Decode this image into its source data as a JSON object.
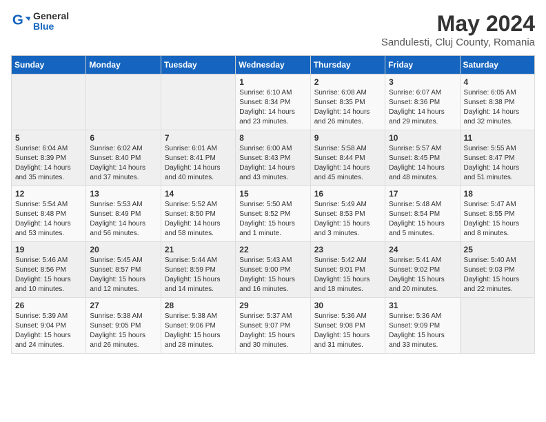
{
  "logo": {
    "general": "General",
    "blue": "Blue"
  },
  "header": {
    "month_year": "May 2024",
    "location": "Sandulesti, Cluj County, Romania"
  },
  "weekdays": [
    "Sunday",
    "Monday",
    "Tuesday",
    "Wednesday",
    "Thursday",
    "Friday",
    "Saturday"
  ],
  "weeks": [
    [
      {
        "day": "",
        "info": ""
      },
      {
        "day": "",
        "info": ""
      },
      {
        "day": "",
        "info": ""
      },
      {
        "day": "1",
        "info": "Sunrise: 6:10 AM\nSunset: 8:34 PM\nDaylight: 14 hours\nand 23 minutes."
      },
      {
        "day": "2",
        "info": "Sunrise: 6:08 AM\nSunset: 8:35 PM\nDaylight: 14 hours\nand 26 minutes."
      },
      {
        "day": "3",
        "info": "Sunrise: 6:07 AM\nSunset: 8:36 PM\nDaylight: 14 hours\nand 29 minutes."
      },
      {
        "day": "4",
        "info": "Sunrise: 6:05 AM\nSunset: 8:38 PM\nDaylight: 14 hours\nand 32 minutes."
      }
    ],
    [
      {
        "day": "5",
        "info": "Sunrise: 6:04 AM\nSunset: 8:39 PM\nDaylight: 14 hours\nand 35 minutes."
      },
      {
        "day": "6",
        "info": "Sunrise: 6:02 AM\nSunset: 8:40 PM\nDaylight: 14 hours\nand 37 minutes."
      },
      {
        "day": "7",
        "info": "Sunrise: 6:01 AM\nSunset: 8:41 PM\nDaylight: 14 hours\nand 40 minutes."
      },
      {
        "day": "8",
        "info": "Sunrise: 6:00 AM\nSunset: 8:43 PM\nDaylight: 14 hours\nand 43 minutes."
      },
      {
        "day": "9",
        "info": "Sunrise: 5:58 AM\nSunset: 8:44 PM\nDaylight: 14 hours\nand 45 minutes."
      },
      {
        "day": "10",
        "info": "Sunrise: 5:57 AM\nSunset: 8:45 PM\nDaylight: 14 hours\nand 48 minutes."
      },
      {
        "day": "11",
        "info": "Sunrise: 5:55 AM\nSunset: 8:47 PM\nDaylight: 14 hours\nand 51 minutes."
      }
    ],
    [
      {
        "day": "12",
        "info": "Sunrise: 5:54 AM\nSunset: 8:48 PM\nDaylight: 14 hours\nand 53 minutes."
      },
      {
        "day": "13",
        "info": "Sunrise: 5:53 AM\nSunset: 8:49 PM\nDaylight: 14 hours\nand 56 minutes."
      },
      {
        "day": "14",
        "info": "Sunrise: 5:52 AM\nSunset: 8:50 PM\nDaylight: 14 hours\nand 58 minutes."
      },
      {
        "day": "15",
        "info": "Sunrise: 5:50 AM\nSunset: 8:52 PM\nDaylight: 15 hours\nand 1 minute."
      },
      {
        "day": "16",
        "info": "Sunrise: 5:49 AM\nSunset: 8:53 PM\nDaylight: 15 hours\nand 3 minutes."
      },
      {
        "day": "17",
        "info": "Sunrise: 5:48 AM\nSunset: 8:54 PM\nDaylight: 15 hours\nand 5 minutes."
      },
      {
        "day": "18",
        "info": "Sunrise: 5:47 AM\nSunset: 8:55 PM\nDaylight: 15 hours\nand 8 minutes."
      }
    ],
    [
      {
        "day": "19",
        "info": "Sunrise: 5:46 AM\nSunset: 8:56 PM\nDaylight: 15 hours\nand 10 minutes."
      },
      {
        "day": "20",
        "info": "Sunrise: 5:45 AM\nSunset: 8:57 PM\nDaylight: 15 hours\nand 12 minutes."
      },
      {
        "day": "21",
        "info": "Sunrise: 5:44 AM\nSunset: 8:59 PM\nDaylight: 15 hours\nand 14 minutes."
      },
      {
        "day": "22",
        "info": "Sunrise: 5:43 AM\nSunset: 9:00 PM\nDaylight: 15 hours\nand 16 minutes."
      },
      {
        "day": "23",
        "info": "Sunrise: 5:42 AM\nSunset: 9:01 PM\nDaylight: 15 hours\nand 18 minutes."
      },
      {
        "day": "24",
        "info": "Sunrise: 5:41 AM\nSunset: 9:02 PM\nDaylight: 15 hours\nand 20 minutes."
      },
      {
        "day": "25",
        "info": "Sunrise: 5:40 AM\nSunset: 9:03 PM\nDaylight: 15 hours\nand 22 minutes."
      }
    ],
    [
      {
        "day": "26",
        "info": "Sunrise: 5:39 AM\nSunset: 9:04 PM\nDaylight: 15 hours\nand 24 minutes."
      },
      {
        "day": "27",
        "info": "Sunrise: 5:38 AM\nSunset: 9:05 PM\nDaylight: 15 hours\nand 26 minutes."
      },
      {
        "day": "28",
        "info": "Sunrise: 5:38 AM\nSunset: 9:06 PM\nDaylight: 15 hours\nand 28 minutes."
      },
      {
        "day": "29",
        "info": "Sunrise: 5:37 AM\nSunset: 9:07 PM\nDaylight: 15 hours\nand 30 minutes."
      },
      {
        "day": "30",
        "info": "Sunrise: 5:36 AM\nSunset: 9:08 PM\nDaylight: 15 hours\nand 31 minutes."
      },
      {
        "day": "31",
        "info": "Sunrise: 5:36 AM\nSunset: 9:09 PM\nDaylight: 15 hours\nand 33 minutes."
      },
      {
        "day": "",
        "info": ""
      }
    ]
  ]
}
